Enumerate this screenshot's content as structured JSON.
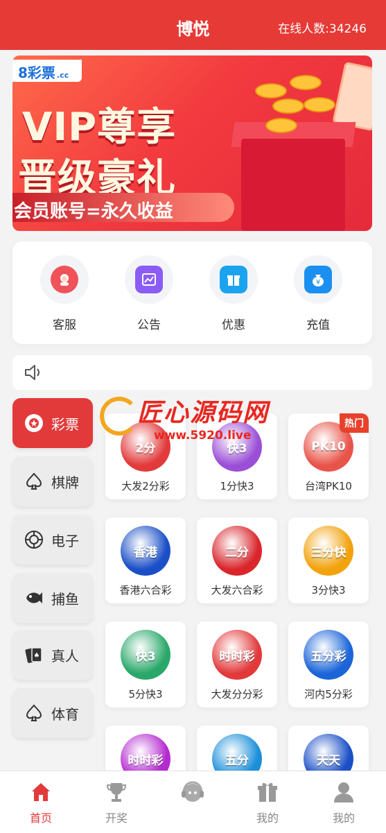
{
  "header": {
    "title": "博悦",
    "online": "在线人数:34246"
  },
  "banner": {
    "logo": "8彩票",
    "logo_sub": ".cc",
    "title_line1": "VIP尊享",
    "title_line2": "晋级豪礼",
    "subtitle": "会员账号=永久收益",
    "slides": 5,
    "active_slide": 1
  },
  "quick_links": [
    {
      "label": "客服",
      "icon": "customer-service-icon",
      "color": "#f0525a"
    },
    {
      "label": "公告",
      "icon": "announcement-icon",
      "color": "#8b5cf6"
    },
    {
      "label": "优惠",
      "icon": "gift-icon",
      "color": "#1aa4f0"
    },
    {
      "label": "充值",
      "icon": "money-bag-icon",
      "color": "#1a8ff0"
    }
  ],
  "notice": {
    "icon": "speaker-icon"
  },
  "sidebar": [
    {
      "label": "彩票",
      "icon": "lottery-icon",
      "active": true
    },
    {
      "label": "棋牌",
      "icon": "spade-icon",
      "active": false
    },
    {
      "label": "电子",
      "icon": "chip-icon",
      "active": false
    },
    {
      "label": "捕鱼",
      "icon": "fish-icon",
      "active": false
    },
    {
      "label": "真人",
      "icon": "cards-icon",
      "active": false
    },
    {
      "label": "体育",
      "icon": "spade-icon",
      "active": false
    }
  ],
  "games": [
    {
      "name": "大发2分彩",
      "thumb": "2分",
      "color": "#e23a3b",
      "hot": false
    },
    {
      "name": "1分快3",
      "thumb": "快3",
      "color": "#9b4fd6",
      "hot": false
    },
    {
      "name": "台湾PK10",
      "thumb": "PK10",
      "color": "#e8544a",
      "hot": true,
      "hot_label": "热门"
    },
    {
      "name": "香港六合彩",
      "thumb": "香港",
      "color": "#1b4fc7",
      "hot": false
    },
    {
      "name": "大发六合彩",
      "thumb": "二分",
      "color": "#d9262c",
      "hot": false
    },
    {
      "name": "3分快3",
      "thumb": "三分快",
      "color": "#f2a20d",
      "hot": false
    },
    {
      "name": "5分快3",
      "thumb": "快3",
      "color": "#2aa86a",
      "hot": false
    },
    {
      "name": "大发分分彩",
      "thumb": "时时彩",
      "color": "#e23a3b",
      "hot": false
    },
    {
      "name": "河内5分彩",
      "thumb": "五分彩",
      "color": "#1b65d9",
      "hot": false
    },
    {
      "name": "",
      "thumb": "时时彩",
      "color": "#b52ad0",
      "hot": false
    },
    {
      "name": "",
      "thumb": "五分",
      "color": "#1b8fd9",
      "hot": false
    },
    {
      "name": "",
      "thumb": "天天",
      "color": "#1b4fc7",
      "hot": false
    }
  ],
  "watermark": {
    "text": "匠心源码网",
    "url": "www.5920.live"
  },
  "tabbar": [
    {
      "label": "首页",
      "icon": "home-icon",
      "active": true
    },
    {
      "label": "开奖",
      "icon": "trophy-icon",
      "active": false
    },
    {
      "label": "",
      "icon": "headset-icon",
      "active": false
    },
    {
      "label": "我的",
      "icon": "gift-icon",
      "active": false
    },
    {
      "label": "我的",
      "icon": "user-icon",
      "active": false
    }
  ],
  "colors": {
    "primary": "#e63a36",
    "active_tab": "#e23a3b"
  }
}
